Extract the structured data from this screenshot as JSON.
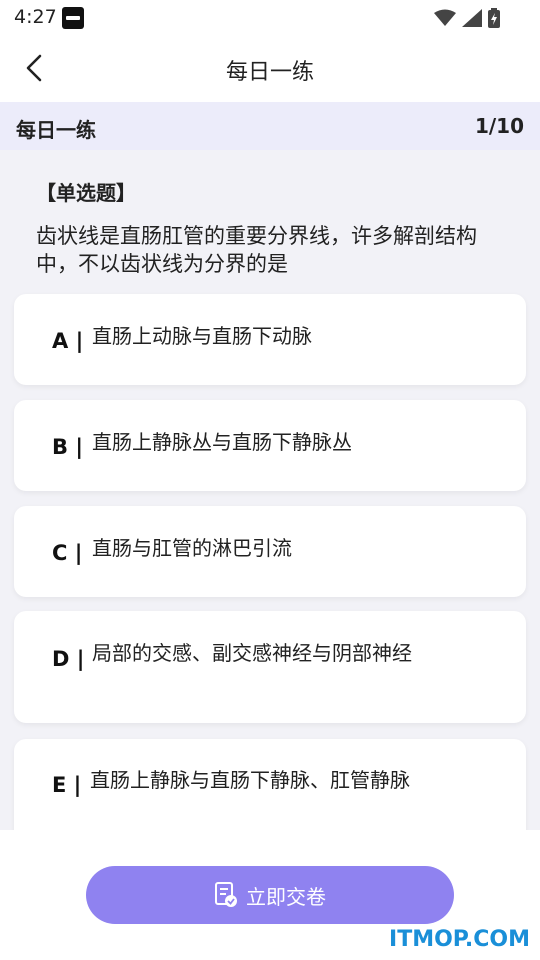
{
  "status_bar": {
    "time": "4:27"
  },
  "header": {
    "title": "每日一练"
  },
  "band": {
    "title": "每日一练",
    "progress": "1/10"
  },
  "question": {
    "type": "【单选题】",
    "text": "齿状线是直肠肛管的重要分界线，许多解剖结构中，不以齿状线为分界的是"
  },
  "options": [
    {
      "letter": "A |",
      "text": "直肠上动脉与直肠下动脉"
    },
    {
      "letter": "B |",
      "text": "直肠上静脉丛与直肠下静脉丛"
    },
    {
      "letter": "C |",
      "text": "直肠与肛管的淋巴引流"
    },
    {
      "letter": "D |",
      "text": "局部的交感、副交感神经与阴部神经"
    },
    {
      "letter": "E |",
      "text": "直肠上静脉与直肠下静脉、肛管静脉"
    }
  ],
  "submit": {
    "label": "立即交卷",
    "icon": "document-check-icon"
  },
  "watermark": "ITMOP.COM",
  "colors": {
    "accent": "#8f82f0",
    "band": "#ececfa",
    "watermark": "#1a8fd8"
  }
}
